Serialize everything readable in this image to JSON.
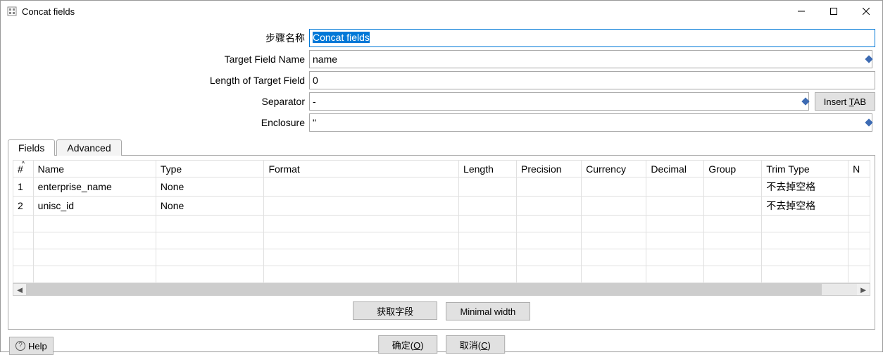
{
  "title": "Concat fields",
  "labels": {
    "step_name": "步骤名称",
    "target_field_name": "Target Field Name",
    "length_of_target_field": "Length of Target Field",
    "separator": "Separator",
    "enclosure": "Enclosure"
  },
  "values": {
    "step_name": "Concat fields",
    "target_field_name": "name",
    "length_of_target_field": "0",
    "separator": "-",
    "enclosure": "\""
  },
  "buttons": {
    "insert_tab_prefix": "Insert ",
    "insert_tab_u": "T",
    "insert_tab_suffix": "AB",
    "get_fields": "获取字段",
    "minimal_width": "Minimal width",
    "ok_prefix": "确定(",
    "ok_u": "O",
    "ok_suffix": ")",
    "cancel_prefix": "取消(",
    "cancel_u": "C",
    "cancel_suffix": ")",
    "help": "Help"
  },
  "tabs": {
    "fields": "Fields",
    "advanced": "Advanced"
  },
  "grid": {
    "headers": {
      "num": "#",
      "name": "Name",
      "type": "Type",
      "format": "Format",
      "length": "Length",
      "precision": "Precision",
      "currency": "Currency",
      "decimal": "Decimal",
      "group": "Group",
      "trim_type": "Trim Type",
      "tail": "N"
    },
    "rows": [
      {
        "num": "1",
        "name": "enterprise_name",
        "type": "None",
        "format": "",
        "length": "",
        "precision": "",
        "currency": "",
        "decimal": "",
        "group": "",
        "trim_type": "不去掉空格"
      },
      {
        "num": "2",
        "name": "unisc_id",
        "type": "None",
        "format": "",
        "length": "",
        "precision": "",
        "currency": "",
        "decimal": "",
        "group": "",
        "trim_type": "不去掉空格"
      }
    ]
  }
}
